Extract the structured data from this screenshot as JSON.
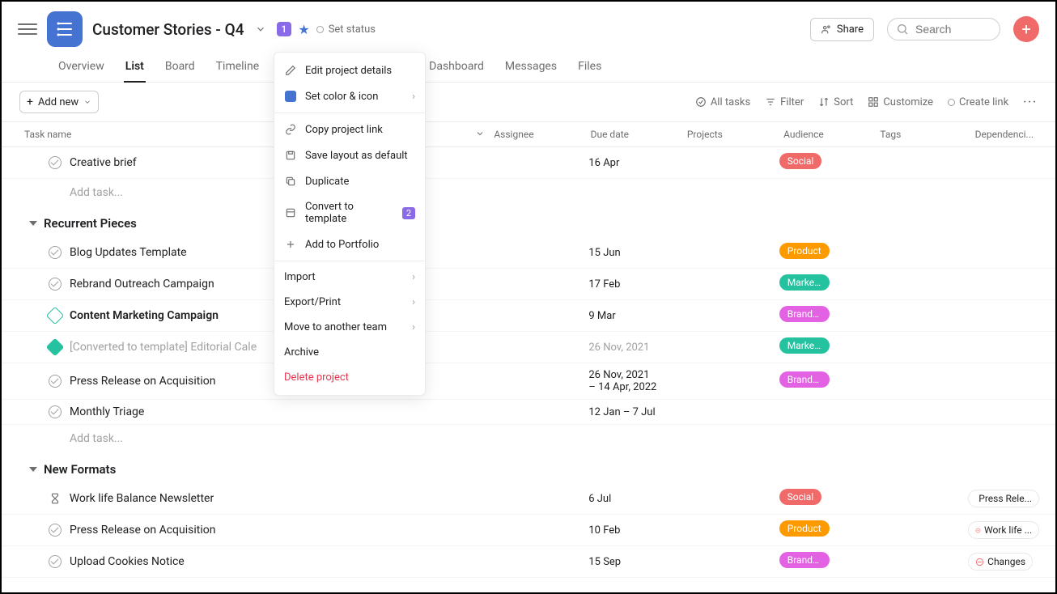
{
  "header": {
    "title": "Customer Stories - Q4",
    "badge": "1",
    "set_status": "Set status",
    "share": "Share",
    "search_placeholder": "Search"
  },
  "tabs": [
    "Overview",
    "List",
    "Board",
    "Timeline",
    "Dashboard",
    "Messages",
    "Files"
  ],
  "toolbar": {
    "add_new": "Add new",
    "all_tasks": "All tasks",
    "filter": "Filter",
    "sort": "Sort",
    "customize": "Customize",
    "create_link": "Create link"
  },
  "columns": {
    "task": "Task name",
    "assignee": "Assignee",
    "due": "Due date",
    "projects": "Projects",
    "audience": "Audience",
    "tags": "Tags",
    "dependencies": "Dependenci..."
  },
  "menu": {
    "edit": "Edit project details",
    "color": "Set color & icon",
    "copy": "Copy project link",
    "save": "Save layout as default",
    "duplicate": "Duplicate",
    "convert": "Convert to template",
    "convert_badge": "2",
    "portfolio": "Add to Portfolio",
    "import": "Import",
    "export": "Export/Print",
    "move": "Move to another team",
    "archive": "Archive",
    "delete": "Delete project"
  },
  "sections": {
    "s0": {
      "tasks": [
        {
          "name": "Creative brief",
          "due": "16 Apr",
          "audience": {
            "label": "Social",
            "color": "#f06a6a"
          }
        }
      ],
      "add": "Add task..."
    },
    "s1": {
      "title": "Recurrent Pieces",
      "tasks": [
        {
          "name": "Blog Updates Template",
          "due": "15 Jun",
          "audience": {
            "label": "Product",
            "color": "#fd9a00"
          }
        },
        {
          "name": "Rebrand Outreach Campaign",
          "due": "17 Feb",
          "audience": {
            "label": "Marketi...",
            "color": "#25c2a0"
          }
        },
        {
          "name": "Content Marketing Campaign",
          "due": "9 Mar",
          "audience": {
            "label": "Branding",
            "color": "#e362e3"
          },
          "bold": true,
          "diamond": true
        },
        {
          "name": "[Converted to template] Editorial Cale",
          "due": "26 Nov, 2021",
          "audience": {
            "label": "Marketi...",
            "color": "#25c2a0"
          },
          "gray": true,
          "greendiamond": true
        },
        {
          "name": "Press Release on Acquisition",
          "due": "26 Nov, 2021 – 14 Apr, 2022",
          "audience": {
            "label": "Branding",
            "color": "#e362e3"
          }
        },
        {
          "name": "Monthly Triage",
          "due": "12 Jan – 7 Jul"
        }
      ],
      "add": "Add task..."
    },
    "s2": {
      "title": "New Formats",
      "tasks": [
        {
          "name": "Work life Balance Newsletter",
          "due": "6 Jul",
          "audience": {
            "label": "Social",
            "color": "#f06a6a"
          },
          "dep": {
            "label": "Press Rele...",
            "icon": "hourglass"
          },
          "hourglass": true
        },
        {
          "name": "Press Release on Acquisition",
          "due": "10 Feb",
          "audience": {
            "label": "Product",
            "color": "#fd9a00"
          },
          "dep": {
            "label": "Work life ...",
            "icon": "block"
          }
        },
        {
          "name": "Upload Cookies Notice",
          "due": "15 Sep",
          "audience": {
            "label": "Branding",
            "color": "#e362e3"
          },
          "dep": {
            "label": "Changes",
            "icon": "block"
          }
        }
      ]
    }
  }
}
